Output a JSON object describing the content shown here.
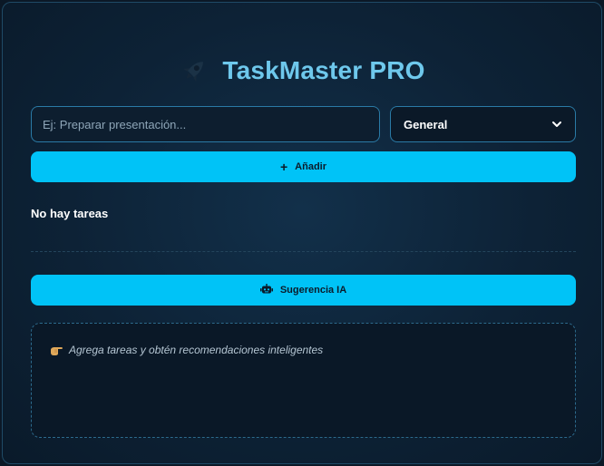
{
  "header": {
    "title": "TaskMaster PRO",
    "icon": "rocket-icon"
  },
  "form": {
    "task_placeholder": "Ej: Preparar presentación...",
    "category_value": "General",
    "add_label": "Añadir"
  },
  "tasks": {
    "empty_message": "No hay tareas",
    "items": []
  },
  "ai": {
    "button_label": "Sugerencia IA",
    "hint": "Agrega tareas y obtén recomendaciones inteligentes"
  },
  "colors": {
    "accent": "#00c3f7",
    "title": "#6ec8ec",
    "border": "#2a7aa6",
    "background": "#0d2236"
  }
}
